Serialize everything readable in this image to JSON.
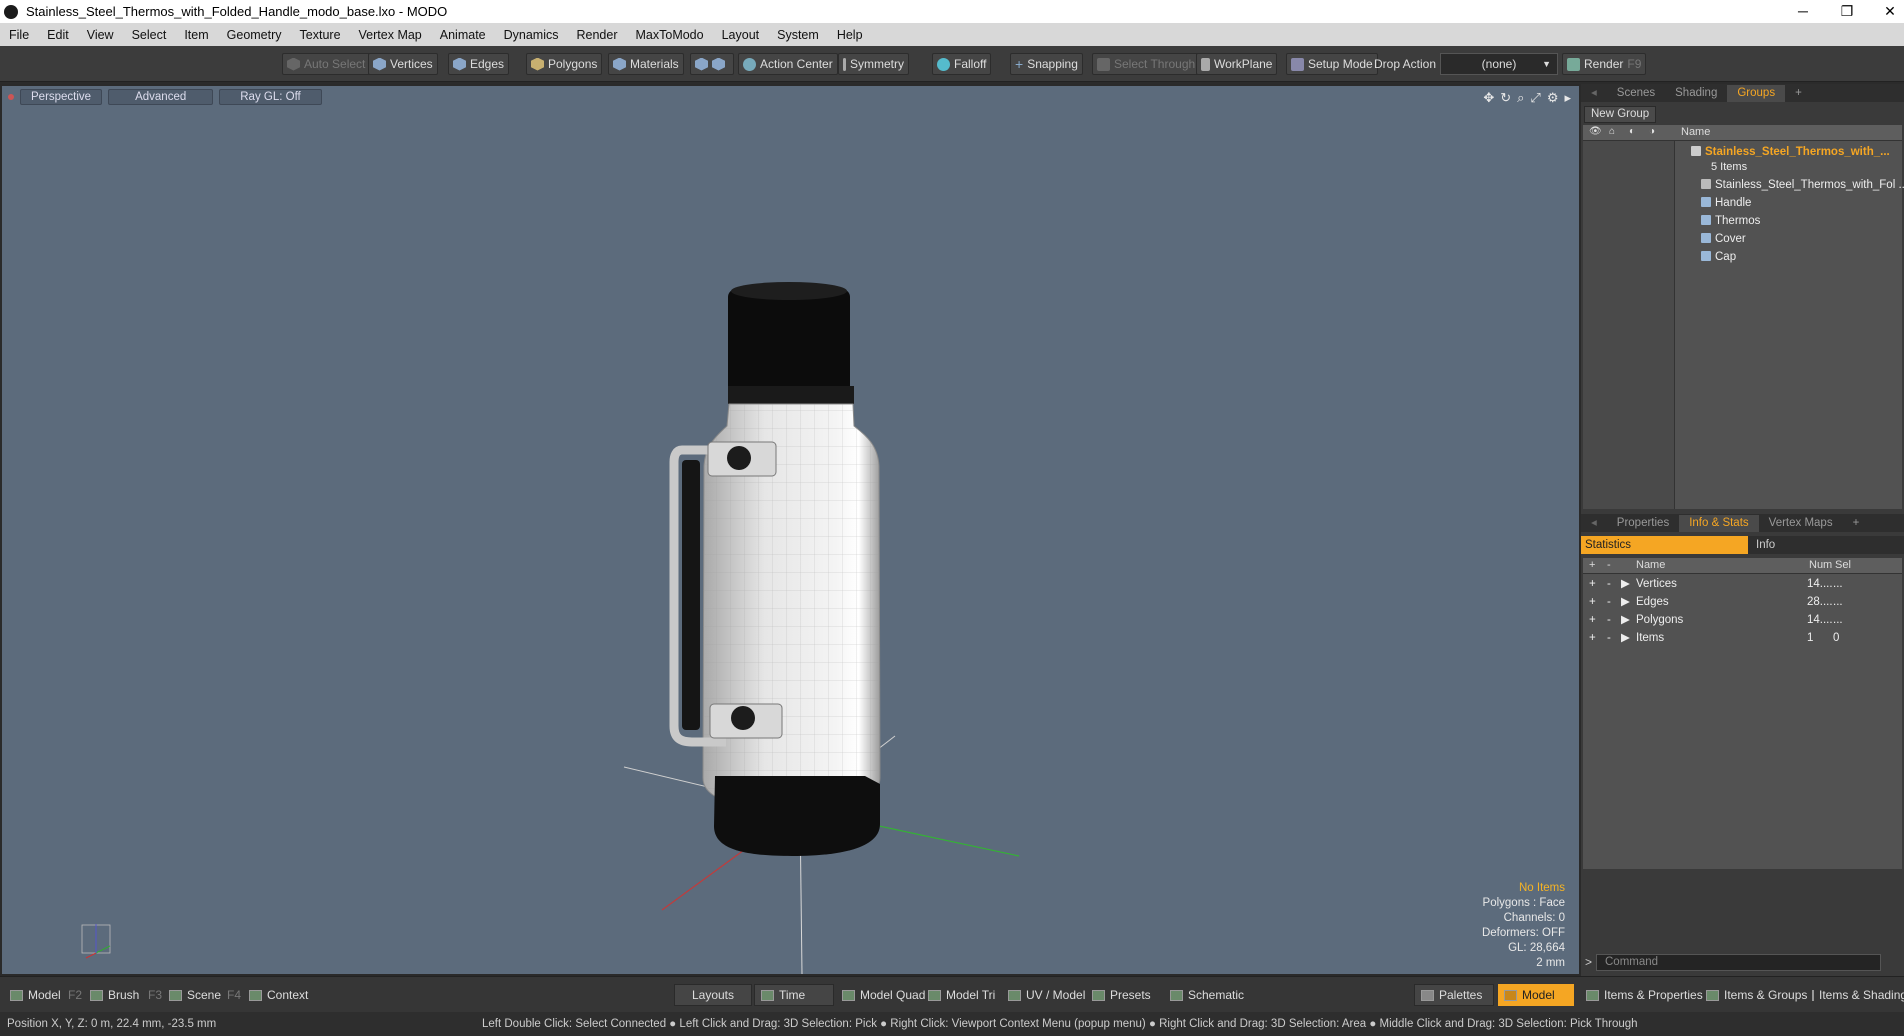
{
  "window": {
    "title": "Stainless_Steel_Thermos_with_Folded_Handle_modo_base.lxo - MODO",
    "minimize": "─",
    "maximize": "❐",
    "close": "✕"
  },
  "menu": [
    "File",
    "Edit",
    "View",
    "Select",
    "Item",
    "Geometry",
    "Texture",
    "Vertex Map",
    "Animate",
    "Dynamics",
    "Render",
    "MaxToModo",
    "Layout",
    "System",
    "Help"
  ],
  "toolbar": {
    "auto_select": "Auto Select",
    "vertices": "Vertices",
    "edges": "Edges",
    "polygons": "Polygons",
    "materials": "Materials",
    "action_center": "Action Center",
    "symmetry": "Symmetry",
    "falloff": "Falloff",
    "snapping": "Snapping",
    "select_through": "Select Through",
    "workplane": "WorkPlane",
    "setup_mode": "Setup Mode",
    "drop_action_label": "Drop Action",
    "drop_action_value": "(none)",
    "render": "Render",
    "render_key": "F9"
  },
  "viewport": {
    "tabs": [
      "Perspective",
      "Advanced",
      "Ray GL: Off"
    ],
    "stats": {
      "no_items": "No Items",
      "polygons": "Polygons : Face",
      "channels": "Channels: 0",
      "deformers": "Deformers: OFF",
      "gl": "GL: 28,664",
      "scale": "2 mm"
    }
  },
  "scenes_panel": {
    "tabs": [
      "Scenes",
      "Shading",
      "Groups"
    ],
    "active_tab": "Groups",
    "new_group": "New Group",
    "col_name": "Name",
    "root": "Stainless_Steel_Thermos_with_...",
    "root_count": "5 Items",
    "children": [
      "Stainless_Steel_Thermos_with_Fol ...",
      "Handle",
      "Thermos",
      "Cover",
      "Cap"
    ]
  },
  "info_panel": {
    "tabs": [
      "Properties",
      "Info & Stats",
      "Vertex Maps"
    ],
    "active_tab": "Info & Stats",
    "sub_tabs": [
      "Statistics",
      "Info"
    ],
    "columns": [
      "Name",
      "Num",
      "Sel"
    ],
    "rows": [
      {
        "name": "Vertices",
        "num": "14....",
        "sel": "..."
      },
      {
        "name": "Edges",
        "num": "28....",
        "sel": "..."
      },
      {
        "name": "Polygons",
        "num": "14....",
        "sel": "..."
      },
      {
        "name": "Items",
        "num": "1",
        "sel": "0"
      }
    ],
    "command_placeholder": "Command"
  },
  "bottom": {
    "model": "Model",
    "model_key": "F2",
    "brush": "Brush",
    "brush_key": "F3",
    "scene": "Scene",
    "scene_key": "F4",
    "context": "Context",
    "layouts": "Layouts",
    "time": "Time",
    "model_quad": "Model Quad",
    "model_tri": "Model Tri",
    "uv_model": "UV / Model",
    "presets": "Presets",
    "schematic": "Schematic",
    "palettes": "Palettes",
    "model_active": "Model",
    "items_properties": "Items & Properties",
    "items_groups": "Items & Groups",
    "items_shading": "Items & Shading"
  },
  "status": {
    "position": "Position X, Y, Z:   0 m, 22.4 mm, -23.5 mm",
    "hint": "Left Double Click: Select Connected ● Left Click and Drag: 3D Selection: Pick ● Right Click: Viewport Context Menu (popup menu) ● Right Click and Drag: 3D Selection: Area ● Middle Click and Drag: 3D Selection: Pick Through"
  },
  "colors": {
    "accent": "#f5a623",
    "viewport_bg": "#5c6b7c"
  }
}
